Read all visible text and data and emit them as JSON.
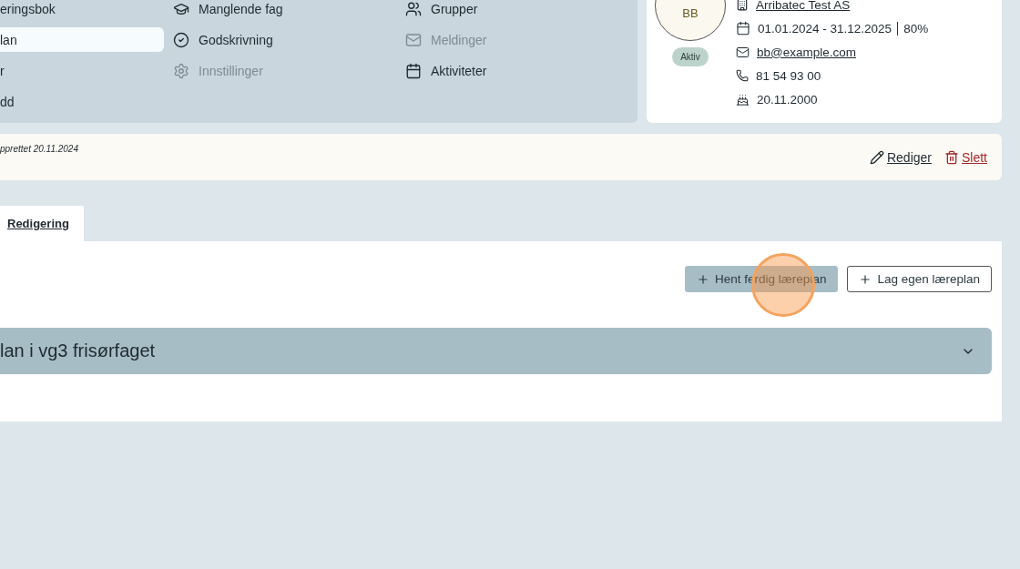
{
  "nav": {
    "columns": [
      [
        {
          "label": "eringsbok",
          "selected": false,
          "disabled": false
        },
        {
          "label": "lan",
          "selected": true,
          "disabled": false
        },
        {
          "label": "r",
          "selected": false,
          "disabled": false
        },
        {
          "label": "dd",
          "selected": false,
          "disabled": false
        }
      ],
      [
        {
          "label": "Manglende fag",
          "selected": false,
          "disabled": false
        },
        {
          "label": "Godskrivning",
          "selected": false,
          "disabled": false
        },
        {
          "label": "Innstillinger",
          "selected": false,
          "disabled": true
        }
      ],
      [
        {
          "label": "Grupper",
          "selected": false,
          "disabled": false
        },
        {
          "label": "Meldinger",
          "selected": false,
          "disabled": true
        },
        {
          "label": "Aktiviteter",
          "selected": false,
          "disabled": false
        }
      ]
    ]
  },
  "profile": {
    "initials": "BB",
    "status": "Aktiv",
    "company": "Arribatec Test AS",
    "period": "01.01.2024 - 31.12.2025",
    "percent": "80%",
    "email": "bb@example.com",
    "phone": "81 54 93 00",
    "birthday": "20.11.2000"
  },
  "banner": {
    "created": "pprettet 20.11.2024",
    "actions": [
      {
        "kind": "edit",
        "label": "Rediger"
      },
      {
        "kind": "delete",
        "label": "Slett"
      }
    ]
  },
  "tabs": [
    {
      "label": "Redigering",
      "selected": true
    }
  ],
  "buttons": [
    {
      "kind": "filled",
      "label": "Hent ferdig læreplan"
    },
    {
      "kind": "outline",
      "label": "Lag egen læreplan"
    }
  ],
  "accordion": {
    "title": "lan i vg3 frisørfaget",
    "expanded": false
  }
}
